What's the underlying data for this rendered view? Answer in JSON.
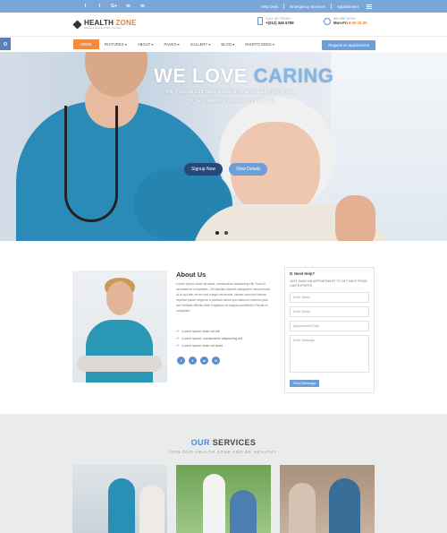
{
  "topbar": {
    "social": [
      "f",
      "t",
      "G+",
      "in",
      "in"
    ],
    "links": [
      "Help Desk",
      "Emergency Services",
      "Appointment"
    ]
  },
  "header": {
    "logo_word1": "HEALTH",
    "logo_word2": "ZONE",
    "tagline": "Doctors & Nursing & Clinic Template",
    "call_label": "CALL US TODAY!",
    "call_number": "+(012) 345 6789",
    "open_label": "WE ARE OPEN",
    "open_days": "Mon-Fri",
    "open_hours": "8.00-16.00"
  },
  "nav": {
    "items": [
      "HOME",
      "FEATURES ▾",
      "ABOUT ▾",
      "PAGES ▾",
      "GALLERY ▾",
      "BLOG ▾",
      "SHORTCODES ▾"
    ],
    "appointment_button": "Request an appointment"
  },
  "hero": {
    "title_part1": "WE LOVE",
    "title_part2": "CARING",
    "subtitle": "We Provide Our best opportunity and quality for fitness for best workout yourself by yourself",
    "btn_primary": "Signup Now",
    "btn_secondary": "View Details",
    "slides": 2,
    "active_slide": 1
  },
  "about": {
    "title": "About Us",
    "text": "Lorem ipsum dolor sit amet, consectetur adipiscing elit. Sunt id accusamus voluptates. Vel facilisis blandit volutpatem assumenda ut in qui iste rerum sed magni reiciendis, facere nesciunt harum repellat ipsum eligendi a pariatur animi quo laborum eveniet plus aut veritatis officiis vitae Fugiatum id magna architecto! Facilis et, voluptate!",
    "checks": [
      "Lorem ipsum dolor sit elit",
      "Lorem ipsum, consectetur adipiscing elit",
      "Lorem ipsum dolor sit amet"
    ],
    "social": [
      "f",
      "t",
      "in",
      "G"
    ]
  },
  "form": {
    "title": "Need Help?",
    "description": "JUST MAKE AN APPOINTMENT TO GET HELP FROM OUR EXPERTS",
    "placeholders": {
      "name": "Enter Name",
      "email": "Enter Email",
      "date": "Appointment Date",
      "message": "Enter Message"
    },
    "submit": "Send Message"
  },
  "services": {
    "title_part1": "OUR",
    "title_part2": "SERVICES",
    "subtitle": "JOIN OUR HEALTH ZONE AND BE HEALTHY."
  },
  "colors": {
    "topbar": "#7aa6d8",
    "accent_orange": "#f28b3b",
    "accent_blue": "#6c9fd8",
    "hero_btn_dark": "#29467a"
  }
}
